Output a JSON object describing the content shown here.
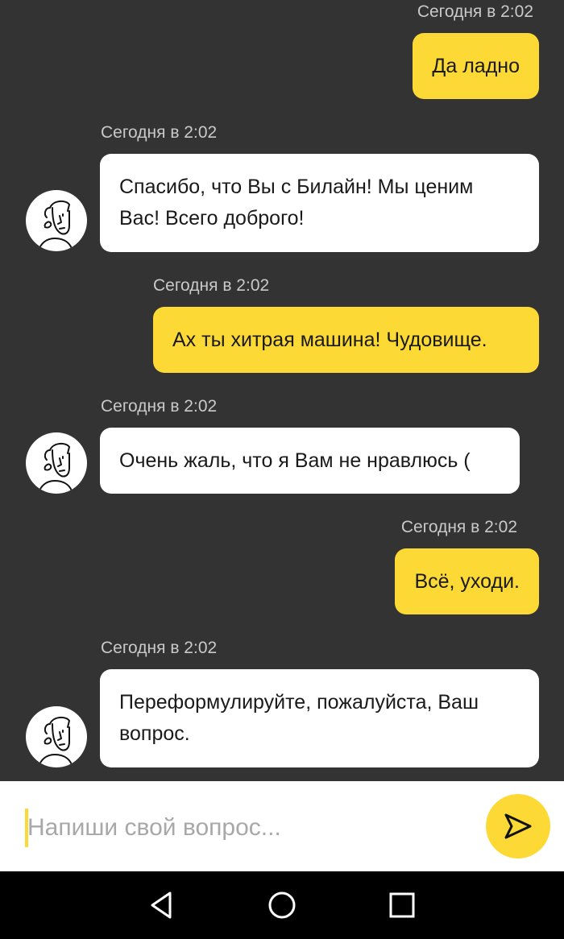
{
  "messages": [
    {
      "sender": "user",
      "time": "Сегодня в 2:02",
      "text": "Да ладно"
    },
    {
      "sender": "bot",
      "time": "Сегодня в 2:02",
      "text_lines": [
        "Спасибо, что Вы с Билайн! Мы ценим",
        "Вас! Всего доброго!"
      ]
    },
    {
      "sender": "user",
      "time": "Сегодня в 2:02",
      "text": "Ах ты хитрая машина! Чудовище."
    },
    {
      "sender": "bot",
      "time": "Сегодня в 2:02",
      "text": "Очень жаль, что я Вам не нравлюсь ("
    },
    {
      "sender": "user",
      "time": "Сегодня в 2:02",
      "text": "Всё, уходи."
    },
    {
      "sender": "bot",
      "time": "Сегодня в 2:02",
      "text_lines": [
        "Переформулируйте, пожалуйста, Ваш",
        "вопрос."
      ]
    }
  ],
  "composer": {
    "placeholder": "Напиши свой вопрос...",
    "value": "",
    "send_icon": "send-arrow-icon"
  },
  "nav": {
    "back_icon": "back-triangle-icon",
    "home_icon": "home-circle-icon",
    "recents_icon": "recents-square-icon"
  },
  "colors": {
    "background": "#333333",
    "user_bubble": "#fcd934",
    "bot_bubble": "#ffffff",
    "timestamp": "#c9c9c9",
    "nav_bar": "#000000"
  }
}
